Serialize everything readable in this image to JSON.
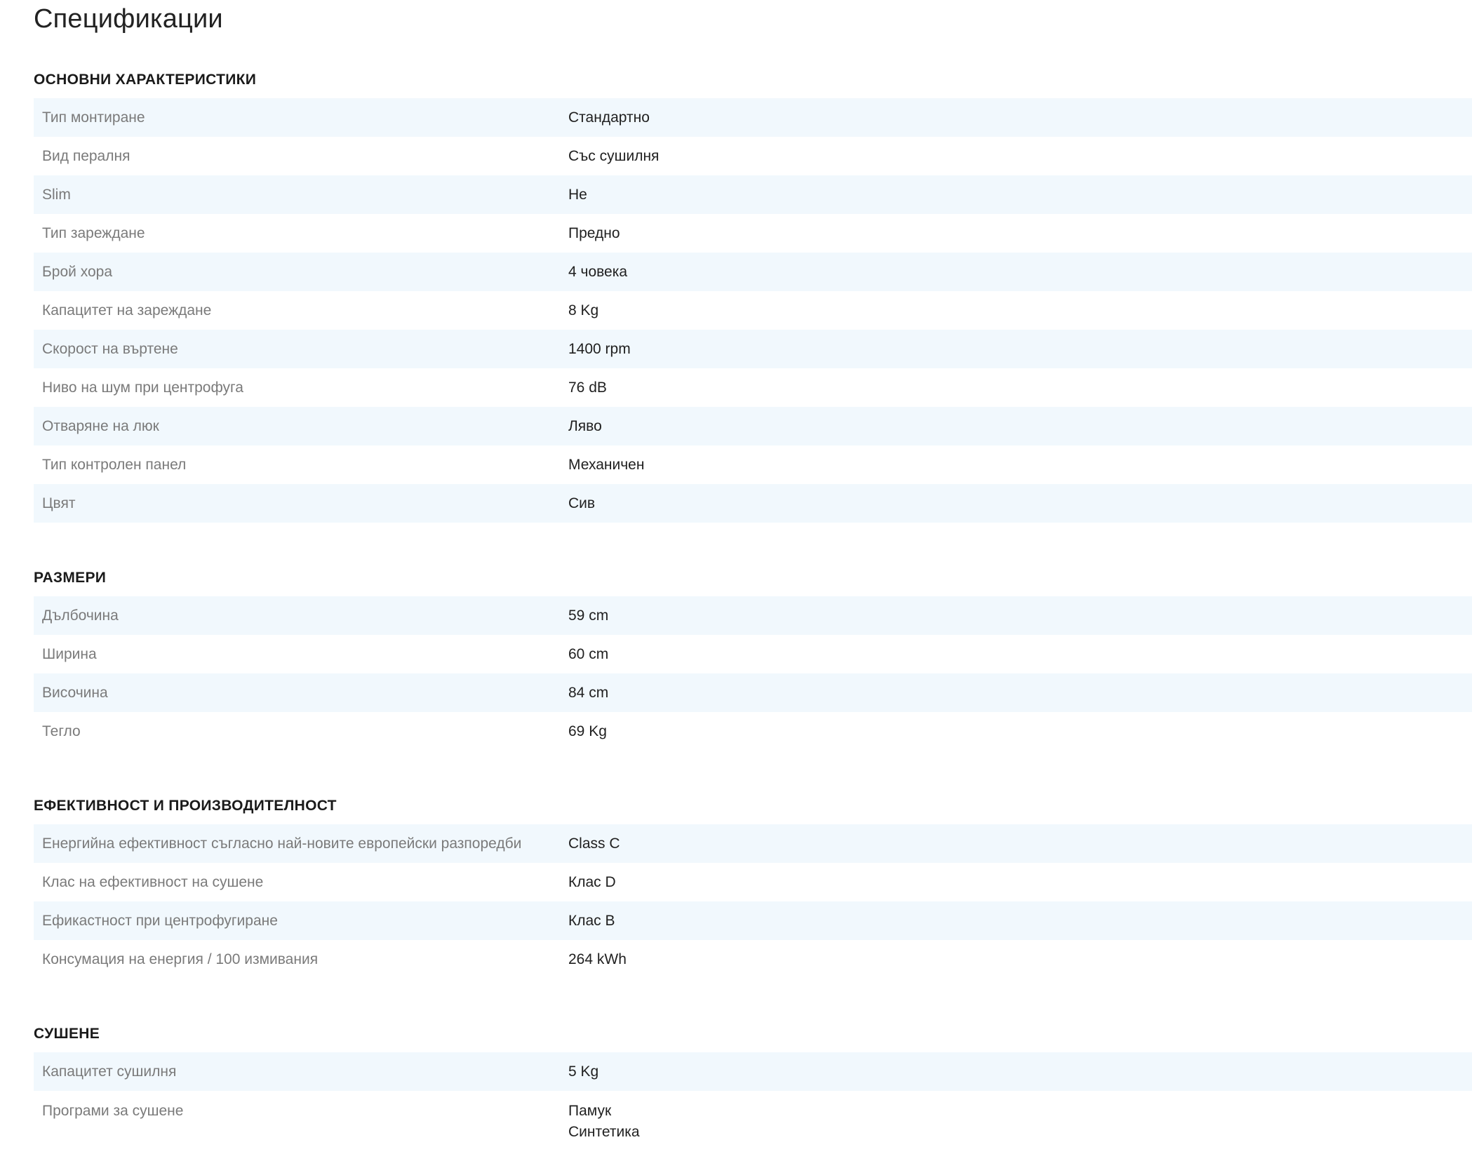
{
  "page_title": "Спецификации",
  "sections": [
    {
      "title": "ОСНОВНИ ХАРАКТЕРИСТИКИ",
      "rows": [
        {
          "label": "Тип монтиране",
          "value": "Стандартно"
        },
        {
          "label": "Вид пералня",
          "value": "Със сушилня"
        },
        {
          "label": "Slim",
          "value": "Не"
        },
        {
          "label": "Тип зареждане",
          "value": "Предно"
        },
        {
          "label": "Брой хора",
          "value": "4 човека"
        },
        {
          "label": "Капацитет на зареждане",
          "value": "8 Kg"
        },
        {
          "label": "Скорост на въртене",
          "value": "1400 rpm"
        },
        {
          "label": "Ниво на шум при центрофуга",
          "value": "76 dB"
        },
        {
          "label": "Отваряне на люк",
          "value": "Ляво"
        },
        {
          "label": "Тип контролен панел",
          "value": "Механичен"
        },
        {
          "label": "Цвят",
          "value": "Сив"
        }
      ]
    },
    {
      "title": "РАЗМЕРИ",
      "rows": [
        {
          "label": "Дълбочина",
          "value": "59 cm"
        },
        {
          "label": "Ширина",
          "value": "60 cm"
        },
        {
          "label": "Височина",
          "value": "84 cm"
        },
        {
          "label": "Тегло",
          "value": "69 Kg"
        }
      ]
    },
    {
      "title": "ЕФЕКТИВНОСТ И ПРОИЗВОДИТЕЛНОСТ",
      "rows": [
        {
          "label": "Енергийна ефективност съгласно най-новите европейски разпоредби",
          "value": "Class C"
        },
        {
          "label": "Клас на ефективност на сушене",
          "value": "Клас D"
        },
        {
          "label": "Ефикастност при центрофугиране",
          "value": "Клас B"
        },
        {
          "label": "Консумация на енергия / 100 измивания",
          "value": "264 kWh"
        }
      ]
    },
    {
      "title": "СУШЕНЕ",
      "rows": [
        {
          "label": "Капацитет сушилня",
          "value": "5 Kg"
        },
        {
          "label": "Програми за сушене",
          "values": [
            "Памук",
            "Синтетика"
          ]
        }
      ]
    }
  ]
}
